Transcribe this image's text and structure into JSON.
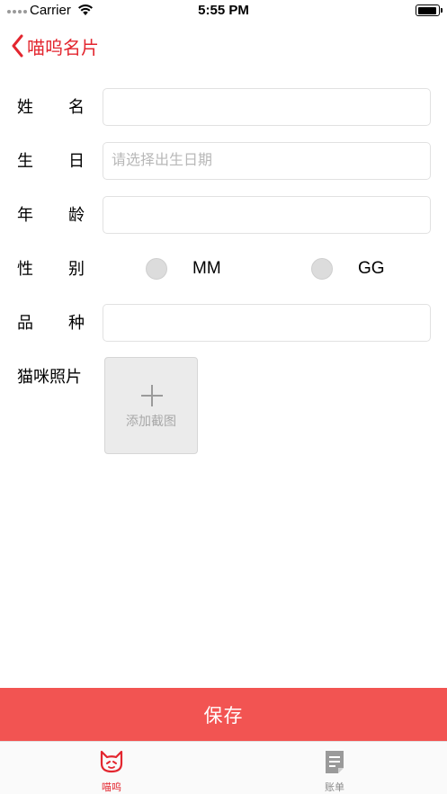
{
  "status_bar": {
    "carrier": "Carrier",
    "time": "5:55 PM",
    "battery_level": 0.95
  },
  "nav": {
    "back_title": "喵呜名片",
    "accent_color": "#e3262f"
  },
  "form": {
    "name": {
      "label_left": "姓",
      "label_right": "名",
      "value": "",
      "placeholder": ""
    },
    "birthday": {
      "label_left": "生",
      "label_right": "日",
      "value": "",
      "placeholder": "请选择出生日期"
    },
    "age": {
      "label_left": "年",
      "label_right": "龄",
      "value": "",
      "placeholder": ""
    },
    "gender": {
      "label_left": "性",
      "label_right": "别",
      "options": [
        {
          "label": "MM",
          "selected": false
        },
        {
          "label": "GG",
          "selected": false
        }
      ]
    },
    "breed": {
      "label_left": "品",
      "label_right": "种",
      "value": "",
      "placeholder": ""
    },
    "photo": {
      "label": "猫咪照片",
      "add_text": "添加截图"
    }
  },
  "save_button": {
    "label": "保存",
    "color": "#f25452"
  },
  "tab_bar": {
    "tabs": [
      {
        "label": "喵呜",
        "icon": "cat-icon",
        "active": true
      },
      {
        "label": "账单",
        "icon": "bill-icon",
        "active": false
      }
    ]
  }
}
